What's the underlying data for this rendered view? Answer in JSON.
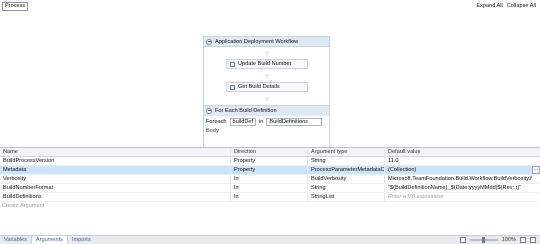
{
  "breadcrumb": {
    "label": "Process"
  },
  "top_actions": {
    "expand_all": "Expand All",
    "collapse_all": "Collapse All"
  },
  "workflow": {
    "title": "Application Deployment Workflow",
    "activities": [
      "Update Build Number",
      "Get Build Details"
    ],
    "foreach": {
      "title": "For Each Build Definition",
      "keyword": "Foreach",
      "item": "buildDef",
      "in_keyword": "in",
      "collection": "BuildDefinitions",
      "body_label": "Body"
    }
  },
  "grid": {
    "columns": [
      "Name",
      "Direction",
      "Argument type",
      "Default value"
    ],
    "rows": [
      {
        "name": "BuildProcessVersion",
        "direction": "Property",
        "type": "String",
        "default": "11.0",
        "placeholder": false,
        "selected": false
      },
      {
        "name": "Metadata",
        "direction": "Property",
        "type": "ProcessParameterMetadataCollection",
        "default": "(Collection)",
        "placeholder": false,
        "selected": true
      },
      {
        "name": "Verbosity",
        "direction": "In",
        "type": "BuildVerbosity",
        "default": "Microsoft.TeamFoundation.Build.Workflow.BuildVerbosity.Normal",
        "placeholder": false,
        "selected": false
      },
      {
        "name": "BuildNumberFormat",
        "direction": "In",
        "type": "String",
        "default": "\"$(BuildDefinitionName)_$(Date:yyyyMMdd)$(Rev:.r)\"",
        "placeholder": false,
        "selected": false
      },
      {
        "name": "BuildDefinitions",
        "direction": "In",
        "type": "StringList",
        "default": "Enter a VB expression",
        "placeholder": true,
        "selected": false
      }
    ],
    "create_label": "Create Argument"
  },
  "statusbar": {
    "tabs": [
      "Variables",
      "Arguments",
      "Imports"
    ],
    "active_tab": "Arguments",
    "zoom": "100%"
  }
}
